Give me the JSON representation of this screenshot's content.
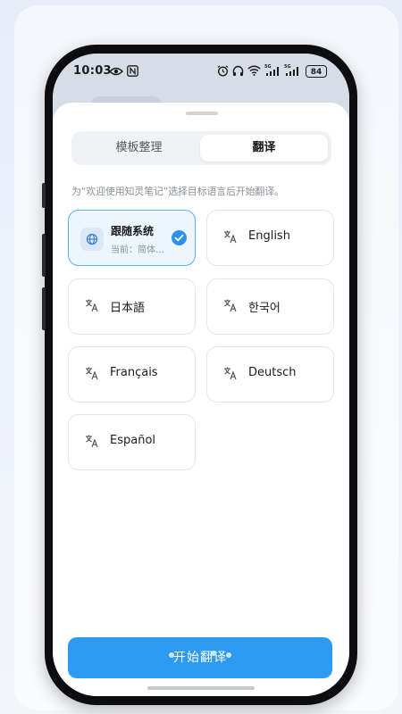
{
  "status_bar": {
    "time": "10:03",
    "battery": "84",
    "icons": [
      "eye-icon",
      "nfc-icon",
      "alarm-icon",
      "headphones-icon",
      "wifi-icon",
      "signal-5g-icon",
      "signal-5g-icon",
      "battery-icon"
    ]
  },
  "tabs": [
    {
      "label": "模板整理",
      "active": false
    },
    {
      "label": "翻译",
      "active": true
    }
  ],
  "hint": "为“欢迎使用知灵笔记”选择目标语言后开始翻译。",
  "languages": [
    {
      "label": "跟随系统",
      "sub": "当前：简体…",
      "selected": true,
      "icon": "globe-icon"
    },
    {
      "label": "English",
      "selected": false,
      "icon": "translate-icon"
    },
    {
      "label": "日本語",
      "selected": false,
      "icon": "translate-icon"
    },
    {
      "label": "한국어",
      "selected": false,
      "icon": "translate-icon"
    },
    {
      "label": "Français",
      "selected": false,
      "icon": "translate-icon"
    },
    {
      "label": "Deutsch",
      "selected": false,
      "icon": "translate-icon"
    },
    {
      "label": "Español",
      "selected": false,
      "icon": "translate-icon"
    }
  ],
  "start_button": "开始翻译",
  "colors": {
    "accent": "#2e9bf0",
    "selected_border": "#5aaff0",
    "selected_bg": "#eef6fd"
  }
}
